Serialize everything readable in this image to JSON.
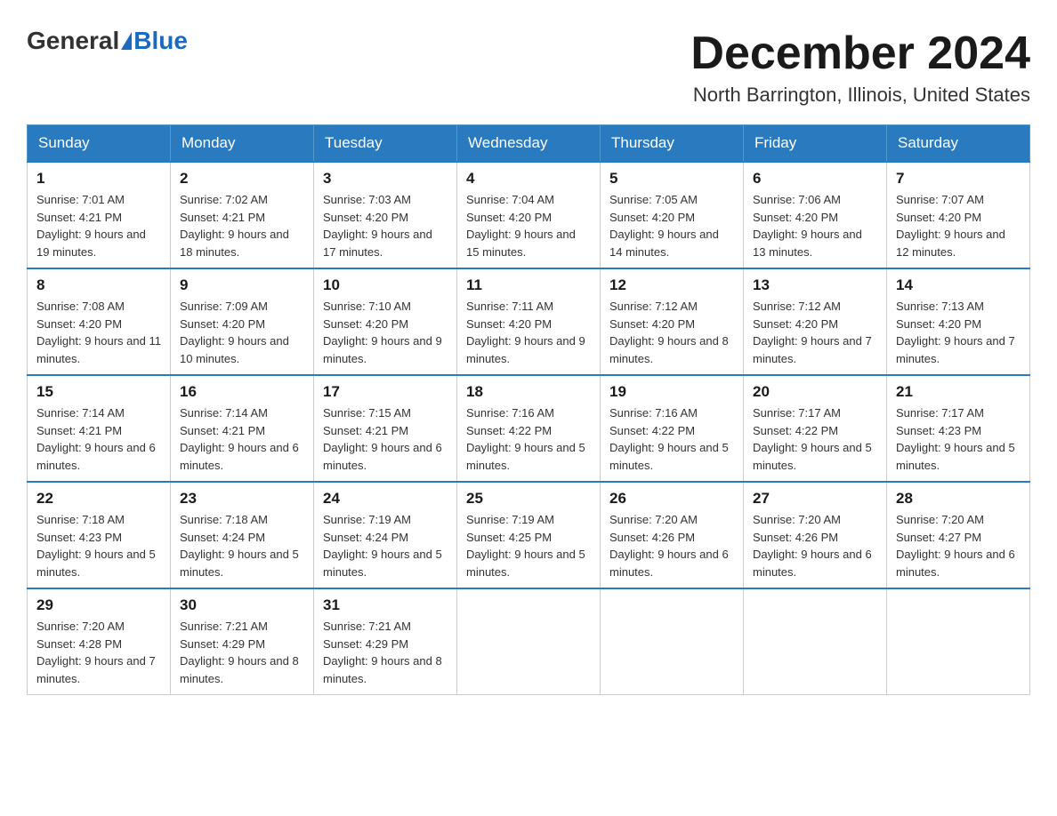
{
  "header": {
    "logo_general": "General",
    "logo_blue": "Blue",
    "month_title": "December 2024",
    "location": "North Barrington, Illinois, United States"
  },
  "days_of_week": [
    "Sunday",
    "Monday",
    "Tuesday",
    "Wednesday",
    "Thursday",
    "Friday",
    "Saturday"
  ],
  "weeks": [
    [
      {
        "date": "1",
        "sunrise": "7:01 AM",
        "sunset": "4:21 PM",
        "daylight": "9 hours and 19 minutes."
      },
      {
        "date": "2",
        "sunrise": "7:02 AM",
        "sunset": "4:21 PM",
        "daylight": "9 hours and 18 minutes."
      },
      {
        "date": "3",
        "sunrise": "7:03 AM",
        "sunset": "4:20 PM",
        "daylight": "9 hours and 17 minutes."
      },
      {
        "date": "4",
        "sunrise": "7:04 AM",
        "sunset": "4:20 PM",
        "daylight": "9 hours and 15 minutes."
      },
      {
        "date": "5",
        "sunrise": "7:05 AM",
        "sunset": "4:20 PM",
        "daylight": "9 hours and 14 minutes."
      },
      {
        "date": "6",
        "sunrise": "7:06 AM",
        "sunset": "4:20 PM",
        "daylight": "9 hours and 13 minutes."
      },
      {
        "date": "7",
        "sunrise": "7:07 AM",
        "sunset": "4:20 PM",
        "daylight": "9 hours and 12 minutes."
      }
    ],
    [
      {
        "date": "8",
        "sunrise": "7:08 AM",
        "sunset": "4:20 PM",
        "daylight": "9 hours and 11 minutes."
      },
      {
        "date": "9",
        "sunrise": "7:09 AM",
        "sunset": "4:20 PM",
        "daylight": "9 hours and 10 minutes."
      },
      {
        "date": "10",
        "sunrise": "7:10 AM",
        "sunset": "4:20 PM",
        "daylight": "9 hours and 9 minutes."
      },
      {
        "date": "11",
        "sunrise": "7:11 AM",
        "sunset": "4:20 PM",
        "daylight": "9 hours and 9 minutes."
      },
      {
        "date": "12",
        "sunrise": "7:12 AM",
        "sunset": "4:20 PM",
        "daylight": "9 hours and 8 minutes."
      },
      {
        "date": "13",
        "sunrise": "7:12 AM",
        "sunset": "4:20 PM",
        "daylight": "9 hours and 7 minutes."
      },
      {
        "date": "14",
        "sunrise": "7:13 AM",
        "sunset": "4:20 PM",
        "daylight": "9 hours and 7 minutes."
      }
    ],
    [
      {
        "date": "15",
        "sunrise": "7:14 AM",
        "sunset": "4:21 PM",
        "daylight": "9 hours and 6 minutes."
      },
      {
        "date": "16",
        "sunrise": "7:14 AM",
        "sunset": "4:21 PM",
        "daylight": "9 hours and 6 minutes."
      },
      {
        "date": "17",
        "sunrise": "7:15 AM",
        "sunset": "4:21 PM",
        "daylight": "9 hours and 6 minutes."
      },
      {
        "date": "18",
        "sunrise": "7:16 AM",
        "sunset": "4:22 PM",
        "daylight": "9 hours and 5 minutes."
      },
      {
        "date": "19",
        "sunrise": "7:16 AM",
        "sunset": "4:22 PM",
        "daylight": "9 hours and 5 minutes."
      },
      {
        "date": "20",
        "sunrise": "7:17 AM",
        "sunset": "4:22 PM",
        "daylight": "9 hours and 5 minutes."
      },
      {
        "date": "21",
        "sunrise": "7:17 AM",
        "sunset": "4:23 PM",
        "daylight": "9 hours and 5 minutes."
      }
    ],
    [
      {
        "date": "22",
        "sunrise": "7:18 AM",
        "sunset": "4:23 PM",
        "daylight": "9 hours and 5 minutes."
      },
      {
        "date": "23",
        "sunrise": "7:18 AM",
        "sunset": "4:24 PM",
        "daylight": "9 hours and 5 minutes."
      },
      {
        "date": "24",
        "sunrise": "7:19 AM",
        "sunset": "4:24 PM",
        "daylight": "9 hours and 5 minutes."
      },
      {
        "date": "25",
        "sunrise": "7:19 AM",
        "sunset": "4:25 PM",
        "daylight": "9 hours and 5 minutes."
      },
      {
        "date": "26",
        "sunrise": "7:20 AM",
        "sunset": "4:26 PM",
        "daylight": "9 hours and 6 minutes."
      },
      {
        "date": "27",
        "sunrise": "7:20 AM",
        "sunset": "4:26 PM",
        "daylight": "9 hours and 6 minutes."
      },
      {
        "date": "28",
        "sunrise": "7:20 AM",
        "sunset": "4:27 PM",
        "daylight": "9 hours and 6 minutes."
      }
    ],
    [
      {
        "date": "29",
        "sunrise": "7:20 AM",
        "sunset": "4:28 PM",
        "daylight": "9 hours and 7 minutes."
      },
      {
        "date": "30",
        "sunrise": "7:21 AM",
        "sunset": "4:29 PM",
        "daylight": "9 hours and 8 minutes."
      },
      {
        "date": "31",
        "sunrise": "7:21 AM",
        "sunset": "4:29 PM",
        "daylight": "9 hours and 8 minutes."
      },
      null,
      null,
      null,
      null
    ]
  ]
}
